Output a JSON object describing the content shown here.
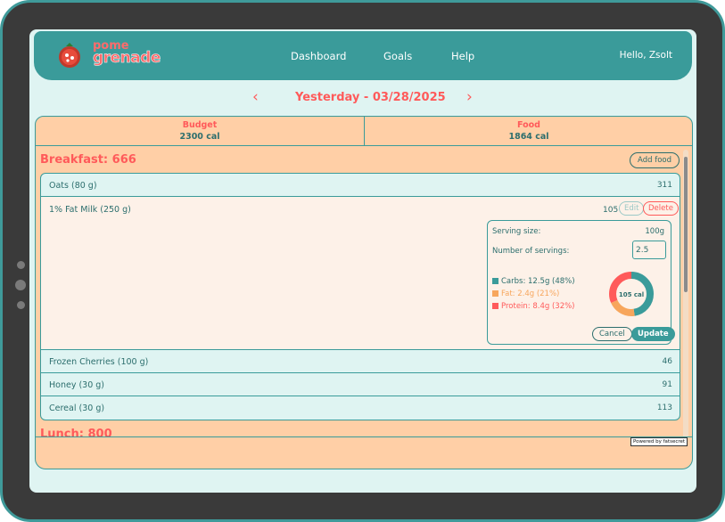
{
  "navbar": {
    "logo_top": "pome",
    "logo_bottom": "grenade",
    "links": [
      "Dashboard",
      "Goals",
      "Help"
    ],
    "greeting": "Hello, Zsolt"
  },
  "date": {
    "title": "Yesterday - 03/28/2025",
    "prev_icon": "chevron-left-icon",
    "next_icon": "chevron-right-icon"
  },
  "summary": {
    "budget_label": "Budget",
    "budget_value": "2300 cal",
    "food_label": "Food",
    "food_value": "1864 cal"
  },
  "breakfast": {
    "title": "Breakfast: 666",
    "add_label": "Add food",
    "items": [
      {
        "name": "Oats (80 g)",
        "cal": "311"
      },
      {
        "name": "Frozen Cherries (100 g)",
        "cal": "46"
      },
      {
        "name": "Honey (30 g)",
        "cal": "91"
      },
      {
        "name": "Cereal (30 g)",
        "cal": "113"
      }
    ],
    "expanded": {
      "name": "1% Fat Milk (250 g)",
      "cal": "105",
      "edit_label": "Edit",
      "delete_label": "Delete",
      "serving_size_label": "Serving size:",
      "serving_size_value": "100g",
      "servings_label": "Number of servings:",
      "servings_value": "2.5",
      "carbs": "Carbs: 12.5g (48%)",
      "fat": "Fat: 2.4g (21%)",
      "protein": "Protein: 8.4g (32%)",
      "donut_label": "105 cal",
      "cancel_label": "Cancel",
      "update_label": "Update",
      "macro_fractions": {
        "carbs": 0.48,
        "fat": 0.21,
        "protein": 0.32
      }
    }
  },
  "lunch_partial": "Lunch: 800",
  "powered_by": "Powered by fatsecret",
  "colors": {
    "teal": "#3a9b9a",
    "coral": "#ff5a5a",
    "peach": "#ffcfa6",
    "carbs": "#3a9b9a",
    "fat": "#f7a65c",
    "protein": "#ff5a5a"
  }
}
